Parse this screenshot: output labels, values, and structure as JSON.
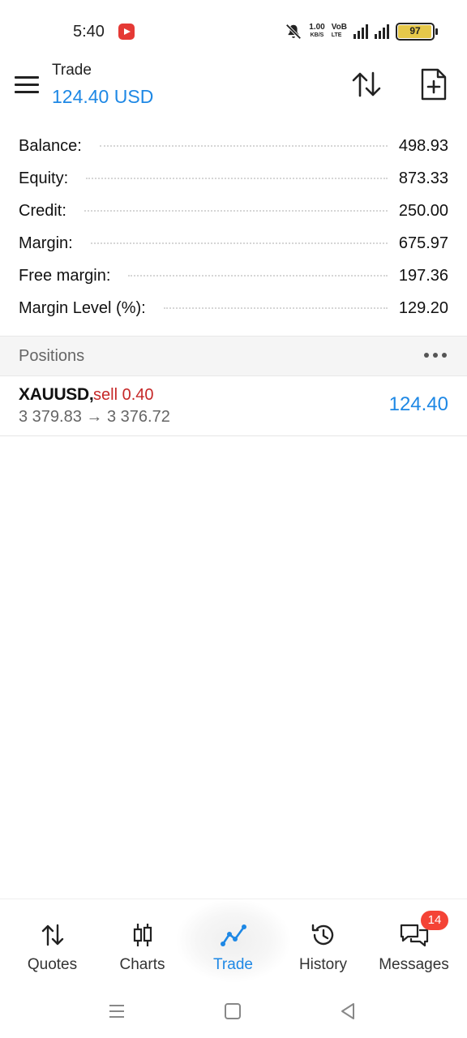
{
  "status_bar": {
    "time": "5:40",
    "net_speed_value": "1.00",
    "net_speed_unit": "KB/S",
    "net_type_top": "VoB",
    "net_type_bottom": "LTE",
    "battery_level": "97",
    "battery_fraction": 0.97
  },
  "header": {
    "title": "Trade",
    "subtitle": "124.40 USD"
  },
  "summary": [
    {
      "label": "Balance:",
      "value": "498.93"
    },
    {
      "label": "Equity:",
      "value": "873.33"
    },
    {
      "label": "Credit:",
      "value": "250.00"
    },
    {
      "label": "Margin:",
      "value": "675.97"
    },
    {
      "label": "Free margin:",
      "value": "197.36"
    },
    {
      "label": "Margin Level (%):",
      "value": "129.20"
    }
  ],
  "positions": {
    "title": "Positions",
    "items": [
      {
        "symbol": "XAUUSD,",
        "side": "sell 0.40",
        "prices": "3 379.83 → 3 376.72",
        "profit": "124.40"
      }
    ]
  },
  "bottom_nav": {
    "items": [
      {
        "label": "Quotes",
        "icon": "sort-arrows-icon"
      },
      {
        "label": "Charts",
        "icon": "candlestick-icon"
      },
      {
        "label": "Trade",
        "icon": "trend-line-icon",
        "active": true
      },
      {
        "label": "History",
        "icon": "history-clock-icon"
      },
      {
        "label": "Messages",
        "icon": "chat-bubbles-icon",
        "badge": "14"
      }
    ]
  },
  "colors": {
    "accent": "#1e88e5",
    "sell": "#c62828",
    "badge": "#f44336"
  }
}
